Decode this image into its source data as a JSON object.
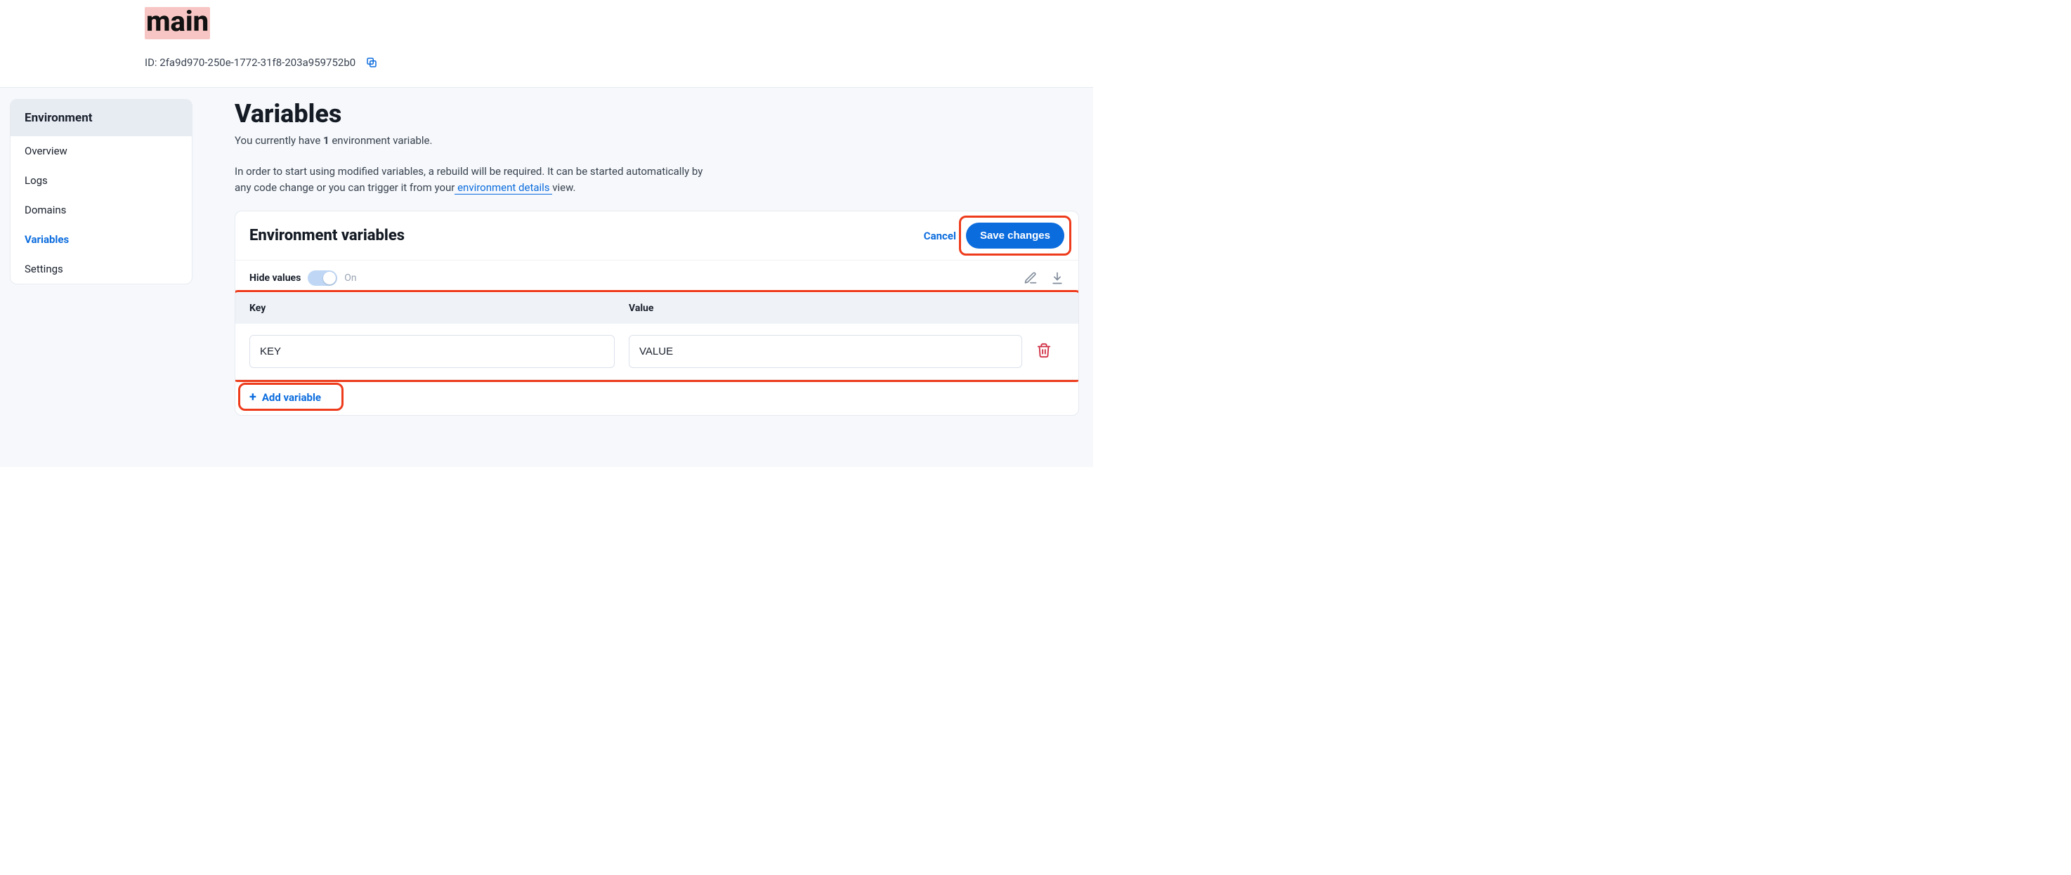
{
  "header": {
    "title": "main",
    "id_prefix": "ID: ",
    "id_value": "2fa9d970-250e-1772-31f8-203a959752b0"
  },
  "sidebar": {
    "title": "Environment",
    "items": [
      {
        "label": "Overview",
        "active": false
      },
      {
        "label": "Logs",
        "active": false
      },
      {
        "label": "Domains",
        "active": false
      },
      {
        "label": "Variables",
        "active": true
      },
      {
        "label": "Settings",
        "active": false
      }
    ]
  },
  "main": {
    "heading": "Variables",
    "summary_pre": "You currently have ",
    "summary_count": "1",
    "summary_post": " environment variable.",
    "help_pre": "In order to start using modified variables, a rebuild will be required. It can be started automatically by any code change or you can trigger it from your",
    "help_link": " environment details ",
    "help_post": "view."
  },
  "card": {
    "title": "Environment variables",
    "cancel": "Cancel",
    "save": "Save changes",
    "hide_label": "Hide values",
    "hide_state": "On",
    "columns": {
      "key": "Key",
      "value": "Value"
    },
    "rows": [
      {
        "key": "KEY",
        "value": "VALUE"
      }
    ],
    "add_label": "Add variable"
  }
}
